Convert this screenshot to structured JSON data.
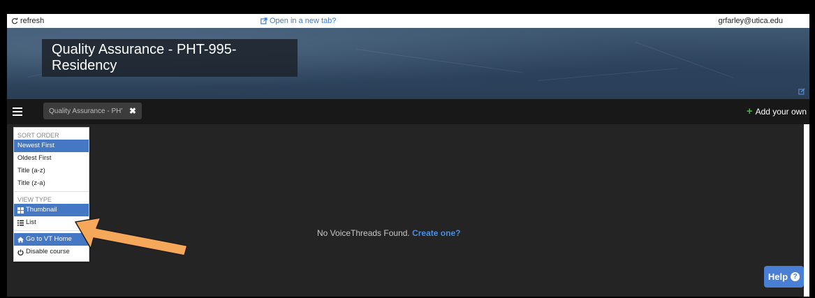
{
  "topbar": {
    "refresh_label": "refresh",
    "newtab_label": "Open in a new tab?",
    "email": "grfarley@utica.edu"
  },
  "banner": {
    "title": "Quality Assurance - PHT-995-Residency"
  },
  "tabbar": {
    "tab_label": "Quality Assurance - PH’",
    "add_label": "Add your own"
  },
  "menu": {
    "sort_header": "SORT ORDER",
    "sort_items": [
      "Newest First",
      "Oldest First",
      "Title (a-z)",
      "Title (z-a)"
    ],
    "sort_selected": "Newest First",
    "view_header": "VIEW TYPE",
    "view_items": [
      "Thumbnail",
      "List"
    ],
    "view_selected": "Thumbnail",
    "home_label": "Go to VT Home",
    "disable_label": "Disable course"
  },
  "main": {
    "empty_text": "No VoiceThreads Found.",
    "create_link": "Create one?"
  },
  "help": {
    "label": "Help"
  },
  "colors": {
    "accent": "#4477c4",
    "link": "#4a8fe0",
    "add_icon": "#3fb03f",
    "arrow": "#f5a85a"
  }
}
